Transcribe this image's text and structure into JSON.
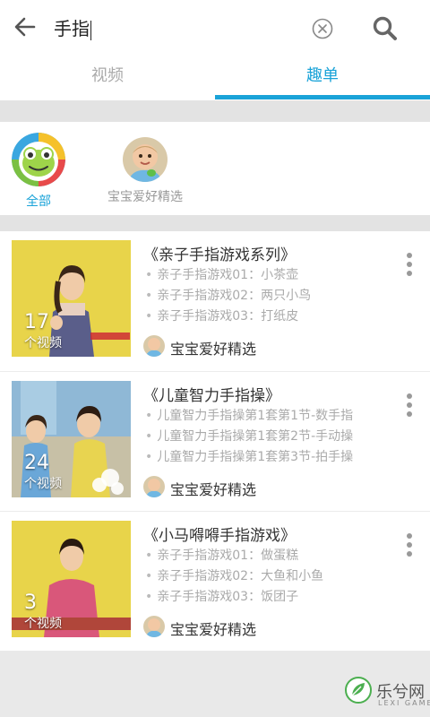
{
  "search": {
    "query": "手指"
  },
  "tabs": [
    {
      "label": "视频",
      "active": false
    },
    {
      "label": "趣单",
      "active": true
    }
  ],
  "categories": [
    {
      "label": "全部",
      "icon": "frog-logo-icon",
      "active": true
    },
    {
      "label": "宝宝爱好精选",
      "icon": "baby-avatar",
      "active": false
    }
  ],
  "playlists": [
    {
      "title": "《亲子手指游戏系列》",
      "count": "17",
      "count_unit": "个视频",
      "episodes": [
        "亲子手指游戏01：小茶壶",
        "亲子手指游戏02：两只小鸟",
        "亲子手指游戏03：打纸皮"
      ],
      "owner": "宝宝爱好精选"
    },
    {
      "title": "《儿童智力手指操》",
      "count": "24",
      "count_unit": "个视频",
      "episodes": [
        "儿童智力手指操第1套第1节-数手指",
        "儿童智力手指操第1套第2节-手动操",
        "儿童智力手指操第1套第3节-拍手操"
      ],
      "owner": "宝宝爱好精选"
    },
    {
      "title": "《小马嘚嘚手指游戏》",
      "count": "3",
      "count_unit": "个视频",
      "episodes": [
        "亲子手指游戏01：做蛋糕",
        "亲子手指游戏02：大鱼和小鱼",
        "亲子手指游戏03：饭团子"
      ],
      "owner": "宝宝爱好精选"
    }
  ],
  "watermark": {
    "text": "乐兮网",
    "sub": "LEXI GAME"
  },
  "colors": {
    "accent": "#1aa3d8",
    "thumb_yellow": "#e8d44a"
  }
}
